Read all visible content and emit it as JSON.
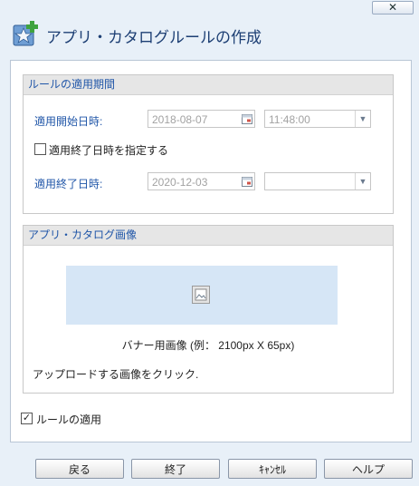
{
  "window": {
    "title": "アプリ・カタログルールの作成",
    "close_glyph": "✕"
  },
  "rule_period": {
    "header": "ルールの適用期間",
    "start_label": "適用開始日時:",
    "start_date": "2018-08-07",
    "start_time": "11:48:00",
    "specify_end_label": "適用終了日時を指定する",
    "specify_end_checked": false,
    "end_label": "適用終了日時:",
    "end_date": "2020-12-03",
    "end_time": ""
  },
  "catalog_image": {
    "header": "アプリ・カタログ画像",
    "banner_note": "バナー用画像 (例： 2100px X 65px)",
    "upload_hint": "アップロードする画像をクリック."
  },
  "apply_rule": {
    "label": "ルールの適用",
    "checked": true
  },
  "buttons": {
    "back": "戻る",
    "finish": "終了",
    "cancel": "ｷｬﾝｾﾙ",
    "help": "ヘルプ"
  },
  "colors": {
    "accent": "#2056a8",
    "title": "#1d3f74",
    "banner": "#d6e6f6"
  },
  "icons": [
    "app-catalog-star-icon",
    "calendar-icon",
    "dropdown-arrow-icon",
    "image-placeholder-icon"
  ]
}
